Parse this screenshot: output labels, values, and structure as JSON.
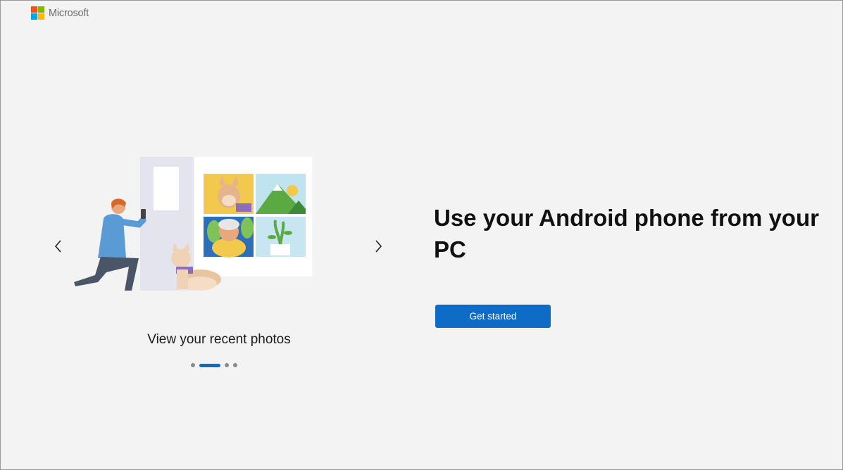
{
  "brand": {
    "name": "Microsoft",
    "logo_colors": [
      "#f25022",
      "#7fba00",
      "#00a4ef",
      "#ffb900"
    ],
    "logo_icon": "microsoft-logo-icon"
  },
  "carousel": {
    "prev_icon": "chevron-left-icon",
    "next_icon": "chevron-right-icon",
    "caption": "View your recent photos",
    "page_count": 4,
    "active_index": 1
  },
  "main": {
    "headline": "Use your Android phone from your PC",
    "get_started_label": "Get started"
  },
  "colors": {
    "accent": "#0f6cc6",
    "background": "#f3f3f3"
  }
}
